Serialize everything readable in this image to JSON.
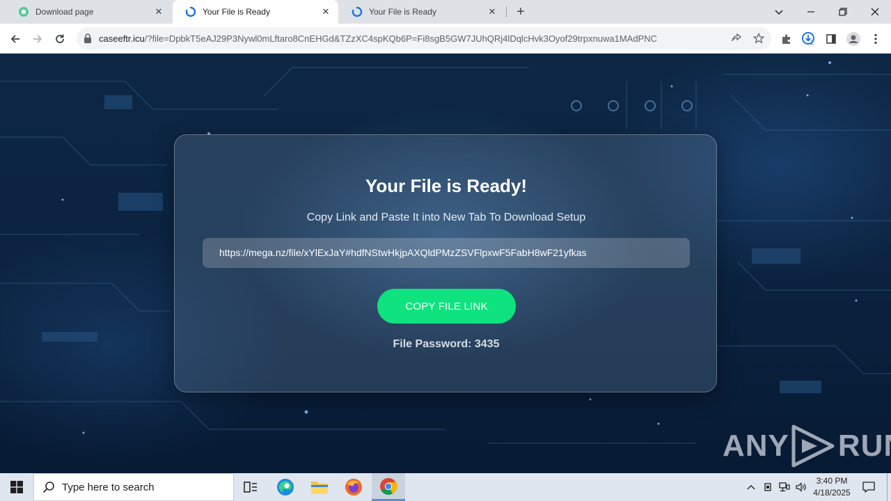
{
  "browser": {
    "tabs": [
      {
        "title": "Download page",
        "active": false
      },
      {
        "title": "Your File is Ready",
        "active": true
      },
      {
        "title": "Your File is Ready",
        "active": false
      }
    ],
    "url_host": "caseeftr.icu",
    "url_rest": "/?file=DpbkT5eAJ29P3Nywl0mLftaro8CnEHGd&TZzXC4spKQb6P=Fi8sgB5GW7JUhQRj4lDqlcHvk3Oyof29trpxnuwa1MAdPNC",
    "download_badge": "2"
  },
  "page": {
    "title": "Your File is Ready!",
    "subtitle": "Copy Link and Paste It into New Tab To Download Setup",
    "link_value": "https://mega.nz/file/xYlExJaY#hdfNStwHkjpAXQldPMzZSVFlpxwF5FabH8wF21yfkas",
    "copy_button": "COPY FILE LINK",
    "password_label": "File Password: 3435",
    "button_color": "#0fe37f"
  },
  "watermark": {
    "left": "ANY",
    "right": "RUN"
  },
  "taskbar": {
    "search_placeholder": "Type here to search",
    "time": "3:40 PM",
    "date": "4/18/2025"
  }
}
